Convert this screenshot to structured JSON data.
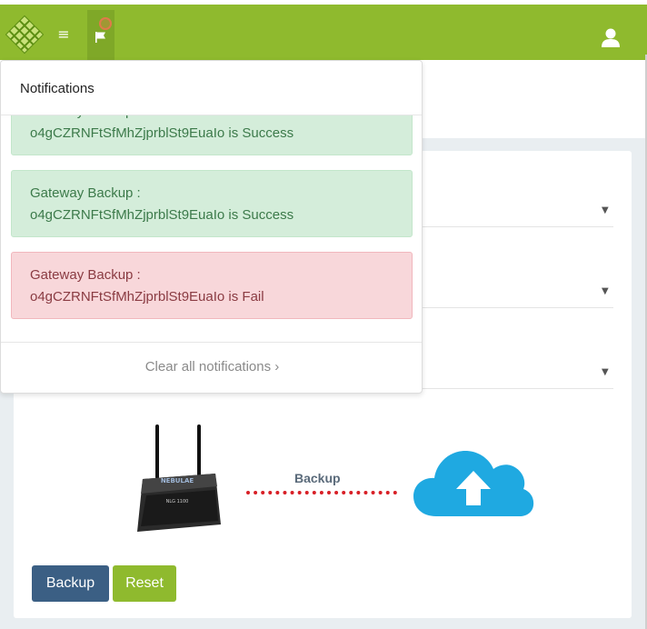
{
  "header": {
    "menu_icon": "hamburger-icon",
    "flag_icon": "flag-icon",
    "user_icon": "user-icon",
    "brand_color": "#8fba2e"
  },
  "notifications": {
    "title": "Notifications",
    "items": [
      {
        "line1": "Gateway Backup :",
        "line2": "o4gCZRNFtSfMhZjprblSt9EuaIo is Success",
        "status": "success"
      },
      {
        "line1": "Gateway Backup :",
        "line2": "o4gCZRNFtSfMhZjprblSt9EuaIo is Success",
        "status": "success"
      },
      {
        "line1": "Gateway Backup :",
        "line2": "o4gCZRNFtSfMhZjprblSt9EuaIo is Fail",
        "status": "fail"
      }
    ],
    "clear_label": "Clear all notifications ›"
  },
  "illustration": {
    "router_brand": "NEBULAE",
    "router_model": "NLG 1100",
    "arrow_label": "Backup"
  },
  "actions": {
    "backup_label": "Backup",
    "reset_label": "Reset"
  }
}
